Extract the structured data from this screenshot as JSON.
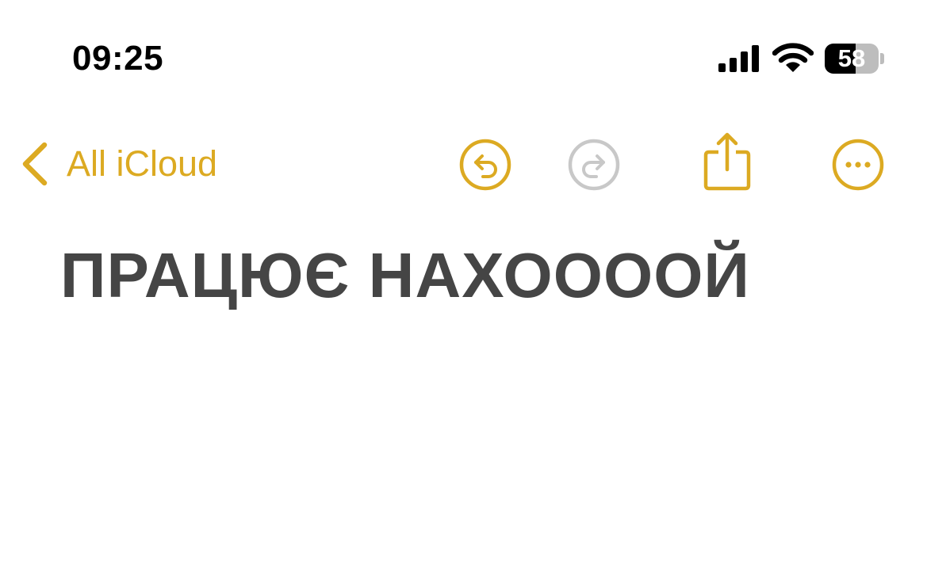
{
  "status_bar": {
    "time": "09:25",
    "battery_level": "58",
    "battery_fraction": 0.58,
    "signal_icon": "cellular-signal-icon",
    "wifi_icon": "wifi-icon"
  },
  "nav": {
    "back_label": "All iCloud",
    "back_icon": "chevron-left-icon",
    "undo_icon": "undo-icon",
    "redo_icon": "redo-icon",
    "redo_enabled": false,
    "share_icon": "share-icon",
    "more_icon": "ellipsis-circle-icon"
  },
  "note": {
    "title": "ПРАЦЮЄ НАХООООЙ"
  },
  "colors": {
    "accent": "#dcaa22",
    "disabled": "#c8c8c8",
    "text": "#454545"
  }
}
